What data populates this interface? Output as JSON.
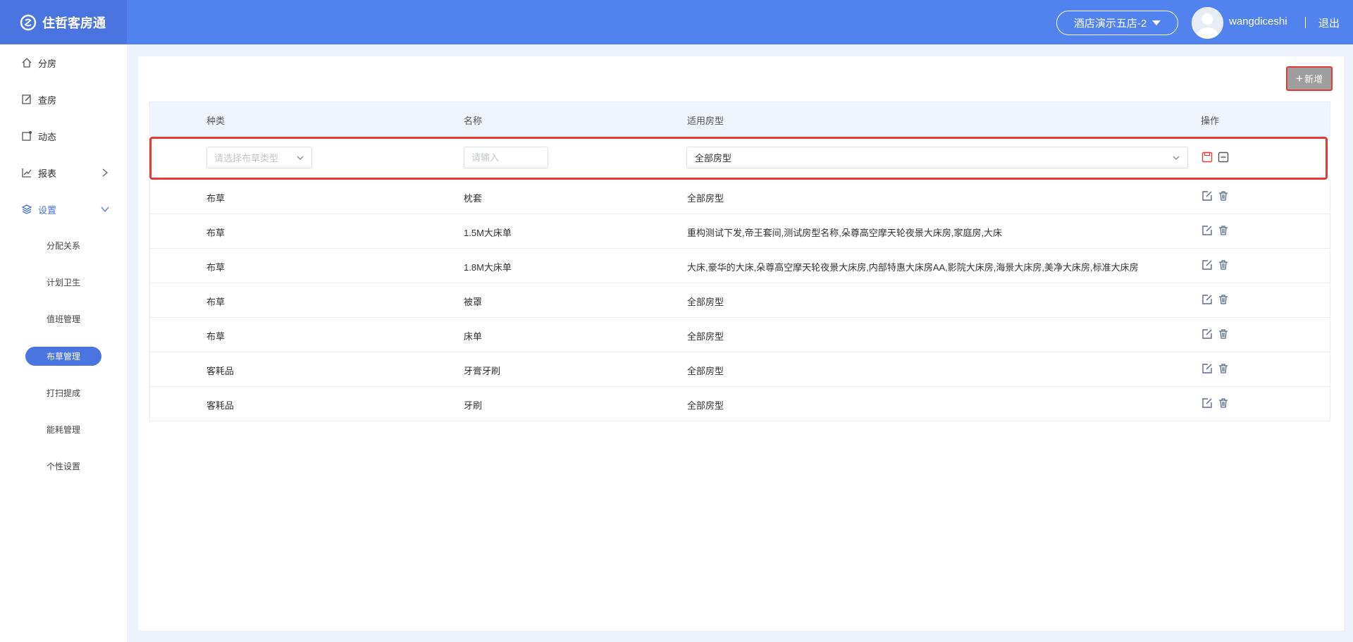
{
  "app": {
    "title": "住哲客房通"
  },
  "header": {
    "hotel": "酒店演示五店-2",
    "username": "wangdiceshi",
    "logout": "退出"
  },
  "sidebar": {
    "items": [
      {
        "label": "分房"
      },
      {
        "label": "查房"
      },
      {
        "label": "动态"
      },
      {
        "label": "报表"
      },
      {
        "label": "设置"
      }
    ],
    "sub_items": [
      {
        "label": "分配关系"
      },
      {
        "label": "计划卫生"
      },
      {
        "label": "值班管理"
      },
      {
        "label": "布草管理"
      },
      {
        "label": "打扫提成"
      },
      {
        "label": "能耗管理"
      },
      {
        "label": "个性设置"
      }
    ]
  },
  "toolbar": {
    "add_label": "新增"
  },
  "table": {
    "headers": [
      "种类",
      "名称",
      "适用房型",
      "操作"
    ],
    "edit_row": {
      "type_placeholder": "请选择布草类型",
      "name_placeholder": "请输入",
      "room_value": "全部房型"
    },
    "rows": [
      {
        "type": "布草",
        "name": "枕套",
        "rooms": "全部房型"
      },
      {
        "type": "布草",
        "name": "1.5M大床单",
        "rooms": "重构测试下发,帝王套间,测试房型名称,朵尊高空摩天轮夜景大床房,家庭房,大床"
      },
      {
        "type": "布草",
        "name": "1.8M大床单",
        "rooms": "大床,豪华的大床,朵尊高空摩天轮夜景大床房,内部特惠大床房AA,影院大床房,海景大床房,美净大床房,标准大床房"
      },
      {
        "type": "布草",
        "name": "被罩",
        "rooms": "全部房型"
      },
      {
        "type": "布草",
        "name": "床单",
        "rooms": "全部房型"
      },
      {
        "type": "客耗品",
        "name": "牙膏牙刷",
        "rooms": "全部房型"
      },
      {
        "type": "客耗品",
        "name": "牙刷",
        "rooms": "全部房型"
      }
    ]
  },
  "colors": {
    "header": "#5282ee",
    "accent": "#4a75e0",
    "highlight": "#e53935"
  }
}
